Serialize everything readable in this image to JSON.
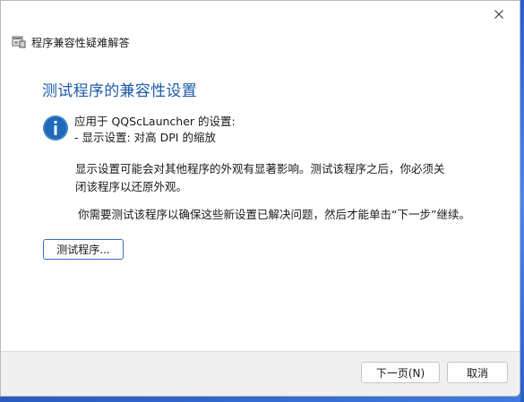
{
  "window": {
    "title": "程序兼容性疑难解答",
    "close_icon": "close-icon"
  },
  "main": {
    "heading": "测试程序的兼容性设置",
    "info_icon": "info-icon",
    "applies_to": "应用于 QQScLauncher 的设置:",
    "setting_line": "- 显示设置: 对高 DPI 的缩放",
    "description": "显示设置可能会对其他程序的外观有显著影响。测试该程序之后，你必须关闭该程序以还原外观。",
    "note": "你需要测试该程序以确保这些新设置已解决问题，然后才能单击“下一步”继续。",
    "test_button": "测试程序..."
  },
  "footer": {
    "next_button": "下一页(N)",
    "cancel_button": "取消"
  },
  "colors": {
    "heading": "#1e5aa8",
    "info_icon": "#1f6ab8",
    "test_button_border": "#3b6fc2"
  }
}
